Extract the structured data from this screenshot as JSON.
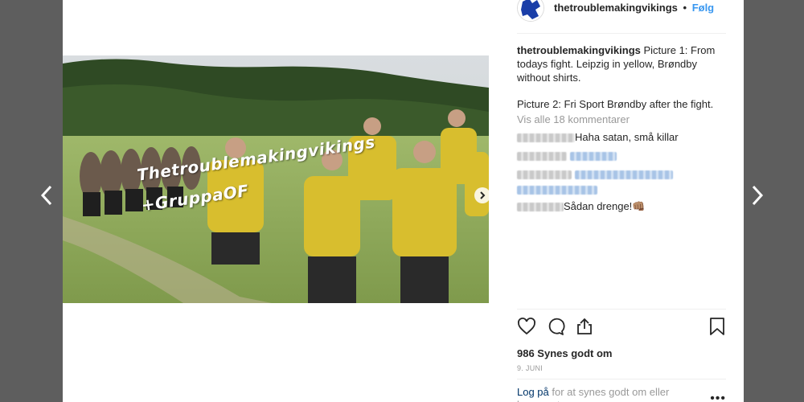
{
  "post": {
    "username": "thetroublemakingvikings",
    "separator": "•",
    "follow_label": "Følg",
    "caption_p1": "Picture 1: From todays fight. Leipzig in yellow, Brøndby without shirts.",
    "caption_p2": "Picture 2: Fri Sport Brøndby after the fight.",
    "view_all_comments": "Vis alle 18 kommentarer",
    "photo_text_line1": "Thetroublemakingvikings",
    "photo_text_line2": "+GruppaOF"
  },
  "comments": [
    {
      "text": "Haha satan, små killar"
    },
    {
      "text": ""
    },
    {
      "text": ""
    },
    {
      "text": "Sådan drenge!👊🏽"
    }
  ],
  "actions": {
    "likes": "986 Synes godt om",
    "date": "9. JUNI",
    "login_link": "Log på",
    "login_rest": " for at synes godt om eller kommentere",
    "more": "•••"
  },
  "icons": [
    "chevron-left-icon",
    "chevron-right-icon",
    "heart-icon",
    "comment-icon",
    "share-icon",
    "bookmark-icon"
  ],
  "colors": {
    "background": "#5e5e5e",
    "accent": "#3897f0",
    "link": "#003569",
    "muted": "#999999"
  }
}
